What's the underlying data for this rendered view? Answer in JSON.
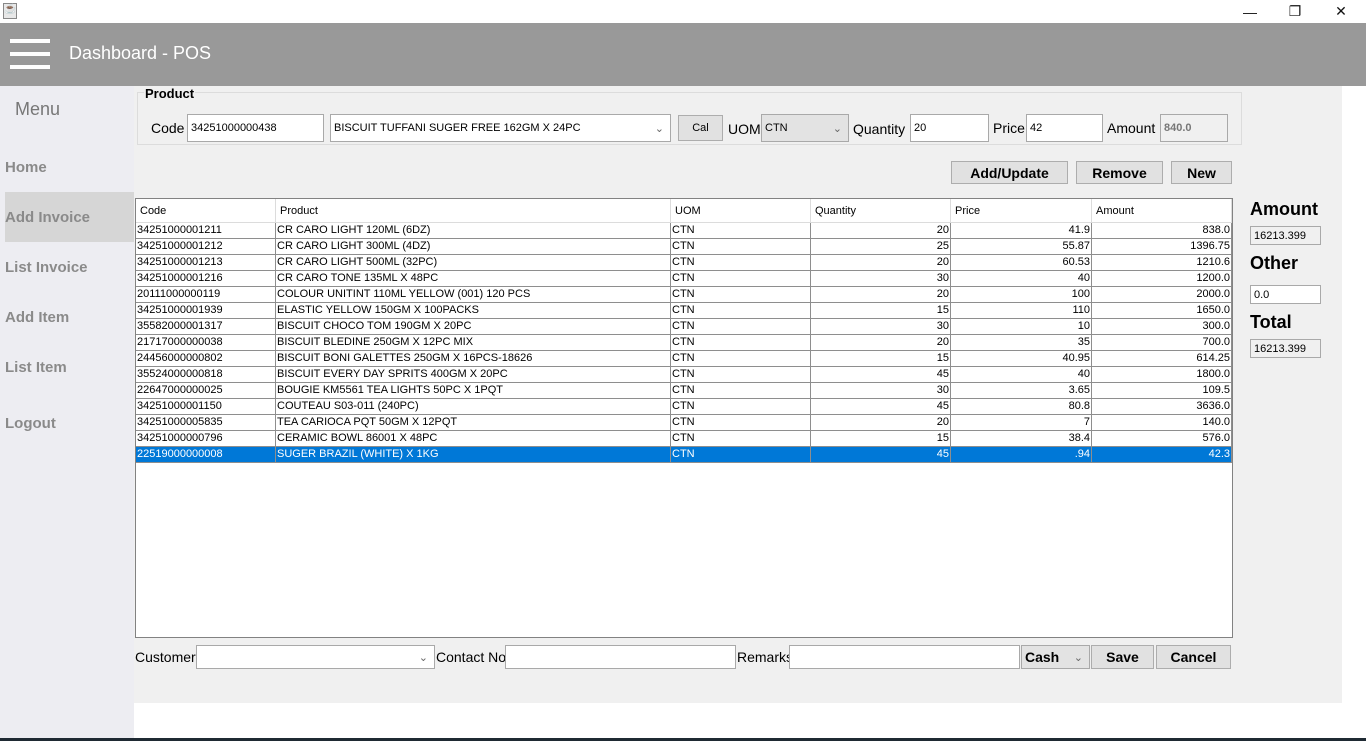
{
  "window": {
    "icon": "java-icon",
    "controls": [
      "minimize-icon",
      "restore-icon",
      "close-icon"
    ]
  },
  "header": {
    "title": "Dashboard - POS",
    "menu_icon": "hamburger-icon"
  },
  "sidebar": {
    "title": "Menu",
    "items": [
      {
        "label": "Home"
      },
      {
        "label": "Add Invoice",
        "active": true
      },
      {
        "label": "List Invoice"
      },
      {
        "label": "Add Item"
      },
      {
        "label": "List Item"
      },
      {
        "label": "Logout"
      }
    ]
  },
  "product": {
    "group_label": "Product",
    "code_label": "Code",
    "code_value": "34251000000438",
    "product_value": "BISCUIT TUFFANI SUGER FREE 162GM X 24PC",
    "cal_label": "Cal",
    "uom_label": "UOM",
    "uom_value": "CTN",
    "quantity_label": "Quantity",
    "quantity_value": "20",
    "price_label": "Price",
    "price_value": "42",
    "amount_label": "Amount",
    "amount_value": "840.0"
  },
  "actions": {
    "add_update": "Add/Update",
    "remove": "Remove",
    "new": "New"
  },
  "table": {
    "columns": [
      "Code",
      "Product",
      "UOM",
      "Quantity",
      "Price",
      "Amount"
    ],
    "rows": [
      [
        "34251000001211",
        "CR CARO LIGHT 120ML (6DZ)",
        "CTN",
        "20",
        "41.9",
        "838.0"
      ],
      [
        "34251000001212",
        "CR CARO LIGHT 300ML (4DZ)",
        "CTN",
        "25",
        "55.87",
        "1396.75"
      ],
      [
        "34251000001213",
        "CR CARO LIGHT 500ML (32PC)",
        "CTN",
        "20",
        "60.53",
        "1210.6"
      ],
      [
        "34251000001216",
        "CR CARO TONE 135ML X 48PC",
        "CTN",
        "30",
        "40",
        "1200.0"
      ],
      [
        "20111000000119",
        "COLOUR UNITINT 110ML YELLOW (001) 120 PCS",
        "CTN",
        "20",
        "100",
        "2000.0"
      ],
      [
        "34251000001939",
        "ELASTIC YELLOW 150GM X 100PACKS",
        "CTN",
        "15",
        "110",
        "1650.0"
      ],
      [
        "35582000001317",
        "BISCUIT  CHOCO TOM 190GM X 20PC",
        "CTN",
        "30",
        "10",
        "300.0"
      ],
      [
        "21717000000038",
        "BISCUIT BLEDINE 250GM X 12PC MIX",
        "CTN",
        "20",
        "35",
        "700.0"
      ],
      [
        "24456000000802",
        "BISCUIT BONI GALETTES 250GM X 16PCS-18626",
        "CTN",
        "15",
        "40.95",
        "614.25"
      ],
      [
        "35524000000818",
        "BISCUIT EVERY DAY SPRITS 400GM X 20PC",
        "CTN",
        "45",
        "40",
        "1800.0"
      ],
      [
        "22647000000025",
        "BOUGIE KM5561 TEA LIGHTS 50PC X 1PQT",
        "CTN",
        "30",
        "3.65",
        "109.5"
      ],
      [
        "34251000001150",
        "COUTEAU S03-011 (240PC)",
        "CTN",
        "45",
        "80.8",
        "3636.0"
      ],
      [
        "34251000005835",
        "TEA CARIOCA PQT 50GM X 12PQT",
        "CTN",
        "20",
        "7",
        "140.0"
      ],
      [
        "34251000000796",
        "CERAMIC BOWL 86001 X 48PC",
        "CTN",
        "15",
        "38.4",
        "576.0"
      ],
      [
        "22519000000008",
        "SUGER BRAZIL (WHITE) X 1KG",
        "CTN",
        "45",
        ".94",
        "42.3"
      ]
    ],
    "selected_index": 14,
    "selection_color": "#0078d7"
  },
  "totals": {
    "amount_label": "Amount",
    "amount_value": "16213.399",
    "other_label": "Other",
    "other_value": "0.0",
    "total_label": "Total",
    "total_value": "16213.399"
  },
  "footer": {
    "customer_label": "Customer",
    "customer_value": "",
    "contact_label": "Contact No",
    "contact_value": "",
    "remarks_label": "Remarks",
    "remarks_value": "",
    "payment_value": "Cash",
    "save": "Save",
    "cancel": "Cancel"
  }
}
